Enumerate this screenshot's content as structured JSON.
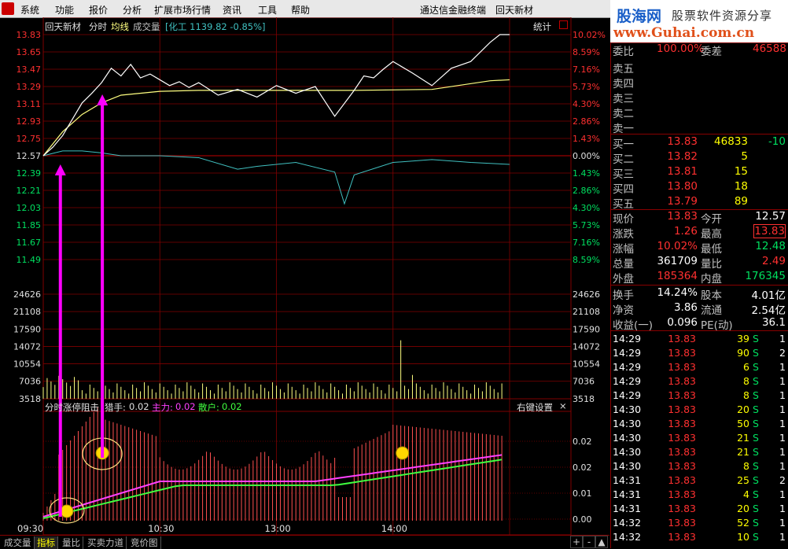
{
  "menu": {
    "items": [
      "系统",
      "功能",
      "报价",
      "分析",
      "扩展市场行情",
      "资讯",
      "工具",
      "帮助"
    ],
    "app_title": "通达信金融终端",
    "stock_name": "回天新材"
  },
  "brand": {
    "name": "股海网",
    "slogan": "股票软件资源分享",
    "url": "www.Guhai.com.cn"
  },
  "chart_header": {
    "stock": "回天新材",
    "mode": "分时",
    "avg_label": "均线",
    "vol_label": "成交量",
    "index_text": "[化工 1139.82 -0.85%]",
    "stats_button": "统计"
  },
  "chart_data": [
    {
      "type": "line",
      "y_ticks_left": [
        "13.83",
        "13.65",
        "13.47",
        "13.29",
        "13.11",
        "12.93",
        "12.75",
        "12.57",
        "12.39",
        "12.21",
        "12.03",
        "11.85",
        "11.67",
        "11.49"
      ],
      "y_ticks_right": [
        "10.02%",
        "8.59%",
        "7.16%",
        "5.73%",
        "4.30%",
        "2.86%",
        "1.43%",
        "0.00%",
        "1.43%",
        "2.86%",
        "4.30%",
        "5.73%",
        "7.16%",
        "8.59%"
      ],
      "ylim": [
        11.31,
        13.83
      ],
      "x_ticks": [
        "09:30",
        "10:30",
        "13:00",
        "14:00"
      ],
      "series": [
        {
          "name": "分时",
          "x": [
            0,
            5,
            10,
            15,
            20,
            25,
            30,
            35,
            40,
            45,
            50,
            55,
            60,
            65,
            70,
            75,
            80,
            90,
            100,
            110,
            120,
            130,
            140,
            150,
            160,
            165,
            170,
            175,
            180,
            190,
            200,
            210,
            220,
            230,
            235,
            240
          ],
          "values": [
            12.57,
            12.66,
            12.78,
            12.95,
            13.12,
            13.22,
            13.33,
            13.48,
            13.4,
            13.52,
            13.38,
            13.42,
            13.36,
            13.3,
            13.34,
            13.28,
            13.33,
            13.2,
            13.26,
            13.18,
            13.3,
            13.22,
            13.29,
            12.98,
            13.25,
            13.4,
            13.38,
            13.47,
            13.55,
            13.43,
            13.3,
            13.48,
            13.55,
            13.75,
            13.83,
            13.83
          ]
        },
        {
          "name": "均线",
          "x": [
            0,
            10,
            20,
            30,
            40,
            60,
            80,
            120,
            160,
            200,
            230,
            240
          ],
          "values": [
            12.57,
            12.82,
            13.0,
            13.12,
            13.2,
            13.24,
            13.25,
            13.25,
            13.25,
            13.26,
            13.35,
            13.36
          ]
        },
        {
          "name": "化工",
          "x": [
            0,
            10,
            20,
            30,
            40,
            60,
            80,
            100,
            110,
            130,
            150,
            155,
            160,
            180,
            200,
            220,
            240
          ],
          "values": [
            12.57,
            12.62,
            12.62,
            12.6,
            12.57,
            12.57,
            12.55,
            12.43,
            12.46,
            12.5,
            12.4,
            12.07,
            12.37,
            12.5,
            12.53,
            12.5,
            12.48
          ]
        }
      ]
    },
    {
      "type": "bar",
      "title": "成交量",
      "y_ticks": [
        "24626",
        "21108",
        "17590",
        "14072",
        "10554",
        "7036",
        "3518"
      ],
      "ylim": [
        0,
        28144
      ],
      "peak_values": [
        {
          "x": 30,
          "value": 7000
        },
        {
          "x": 184,
          "value": 13500
        },
        {
          "x": 190,
          "value": 5500
        }
      ]
    },
    {
      "type": "bar",
      "title": "分时涨停阻击",
      "legend": [
        {
          "name": "猎手",
          "value": "0.02"
        },
        {
          "name": "主力",
          "value": "0.02"
        },
        {
          "name": "散户",
          "value": "0.02"
        }
      ],
      "y_ticks": [
        "0.02",
        "0.02",
        "0.01",
        "0.00"
      ],
      "ylim": [
        0,
        0.028
      ]
    }
  ],
  "indicator_header": {
    "name": "分时涨停阻击",
    "hunter_label": "猎手:",
    "hunter_val": "0.02",
    "main_label": "主力:",
    "main_val": "0.02",
    "retail_label": "散户:",
    "retail_val": "0.02",
    "settings": "右键设置",
    "close": "×"
  },
  "quote": {
    "top_label": "委比",
    "top_val": "100.00%",
    "top_label2": "委差",
    "top_val2": "46588",
    "sell": [
      {
        "label": "卖五",
        "price": "",
        "vol": "",
        "chg": ""
      },
      {
        "label": "卖四",
        "price": "",
        "vol": "",
        "chg": ""
      },
      {
        "label": "卖三",
        "price": "",
        "vol": "",
        "chg": ""
      },
      {
        "label": "卖二",
        "price": "",
        "vol": "",
        "chg": ""
      },
      {
        "label": "卖一",
        "price": "",
        "vol": "",
        "chg": ""
      }
    ],
    "buy": [
      {
        "label": "买一",
        "price": "13.83",
        "vol": "46833",
        "chg": "-10"
      },
      {
        "label": "买二",
        "price": "13.82",
        "vol": "5",
        "chg": ""
      },
      {
        "label": "买三",
        "price": "13.81",
        "vol": "15",
        "chg": ""
      },
      {
        "label": "买四",
        "price": "13.80",
        "vol": "18",
        "chg": ""
      },
      {
        "label": "买五",
        "price": "13.79",
        "vol": "89",
        "chg": ""
      }
    ],
    "stats": [
      {
        "l1": "现价",
        "v1": "13.83",
        "l2": "今开",
        "v2": "12.57",
        "c1": "red",
        "c2": "white"
      },
      {
        "l1": "涨跌",
        "v1": "1.26",
        "l2": "最高",
        "v2": "13.83",
        "c1": "red",
        "c2": "red",
        "box": true
      },
      {
        "l1": "涨幅",
        "v1": "10.02%",
        "l2": "最低",
        "v2": "12.48",
        "c1": "red",
        "c2": "green"
      },
      {
        "l1": "总量",
        "v1": "361709",
        "l2": "量比",
        "v2": "2.49",
        "c1": "white",
        "c2": "red"
      },
      {
        "l1": "外盘",
        "v1": "185364",
        "l2": "内盘",
        "v2": "176345",
        "c1": "red",
        "c2": "green"
      }
    ],
    "fund": [
      {
        "l1": "换手",
        "v1": "14.24%",
        "l2": "股本",
        "v2": "4.01亿"
      },
      {
        "l1": "净资",
        "v1": "3.86",
        "l2": "流通",
        "v2": "2.54亿"
      },
      {
        "l1": "收益(一)",
        "v1": "0.096",
        "l2": "PE(动)",
        "v2": "36.1"
      }
    ],
    "ticks": [
      {
        "t": "14:29",
        "p": "13.83",
        "v": "39",
        "s": "S",
        "n": "1"
      },
      {
        "t": "14:29",
        "p": "13.83",
        "v": "90",
        "s": "S",
        "n": "2"
      },
      {
        "t": "14:29",
        "p": "13.83",
        "v": "6",
        "s": "S",
        "n": "1"
      },
      {
        "t": "14:29",
        "p": "13.83",
        "v": "8",
        "s": "S",
        "n": "1"
      },
      {
        "t": "14:29",
        "p": "13.83",
        "v": "8",
        "s": "S",
        "n": "1"
      },
      {
        "t": "14:30",
        "p": "13.83",
        "v": "20",
        "s": "S",
        "n": "1"
      },
      {
        "t": "14:30",
        "p": "13.83",
        "v": "50",
        "s": "S",
        "n": "1"
      },
      {
        "t": "14:30",
        "p": "13.83",
        "v": "21",
        "s": "S",
        "n": "1"
      },
      {
        "t": "14:30",
        "p": "13.83",
        "v": "21",
        "s": "S",
        "n": "1"
      },
      {
        "t": "14:30",
        "p": "13.83",
        "v": "8",
        "s": "S",
        "n": "1"
      },
      {
        "t": "14:31",
        "p": "13.83",
        "v": "25",
        "s": "S",
        "n": "2"
      },
      {
        "t": "14:31",
        "p": "13.83",
        "v": "4",
        "s": "S",
        "n": "1"
      },
      {
        "t": "14:31",
        "p": "13.83",
        "v": "20",
        "s": "S",
        "n": "1"
      },
      {
        "t": "14:32",
        "p": "13.83",
        "v": "52",
        "s": "S",
        "n": "1"
      },
      {
        "t": "14:32",
        "p": "13.83",
        "v": "10",
        "s": "S",
        "n": "1"
      }
    ]
  },
  "tabs": [
    "成交量",
    "指标",
    "量比",
    "买卖力道",
    "竞价图"
  ],
  "tab_controls": [
    "+",
    "-",
    "▲"
  ],
  "colors": {
    "grid": "#800000",
    "price": "#ffffff",
    "avg": "#ffff80",
    "index": "#40c0c0",
    "up": "#ff3030",
    "down": "#00e060",
    "arrow": "#ff00ff",
    "main": "#ff40ff",
    "retail": "#40ff40",
    "yellow": "#ffff00"
  }
}
